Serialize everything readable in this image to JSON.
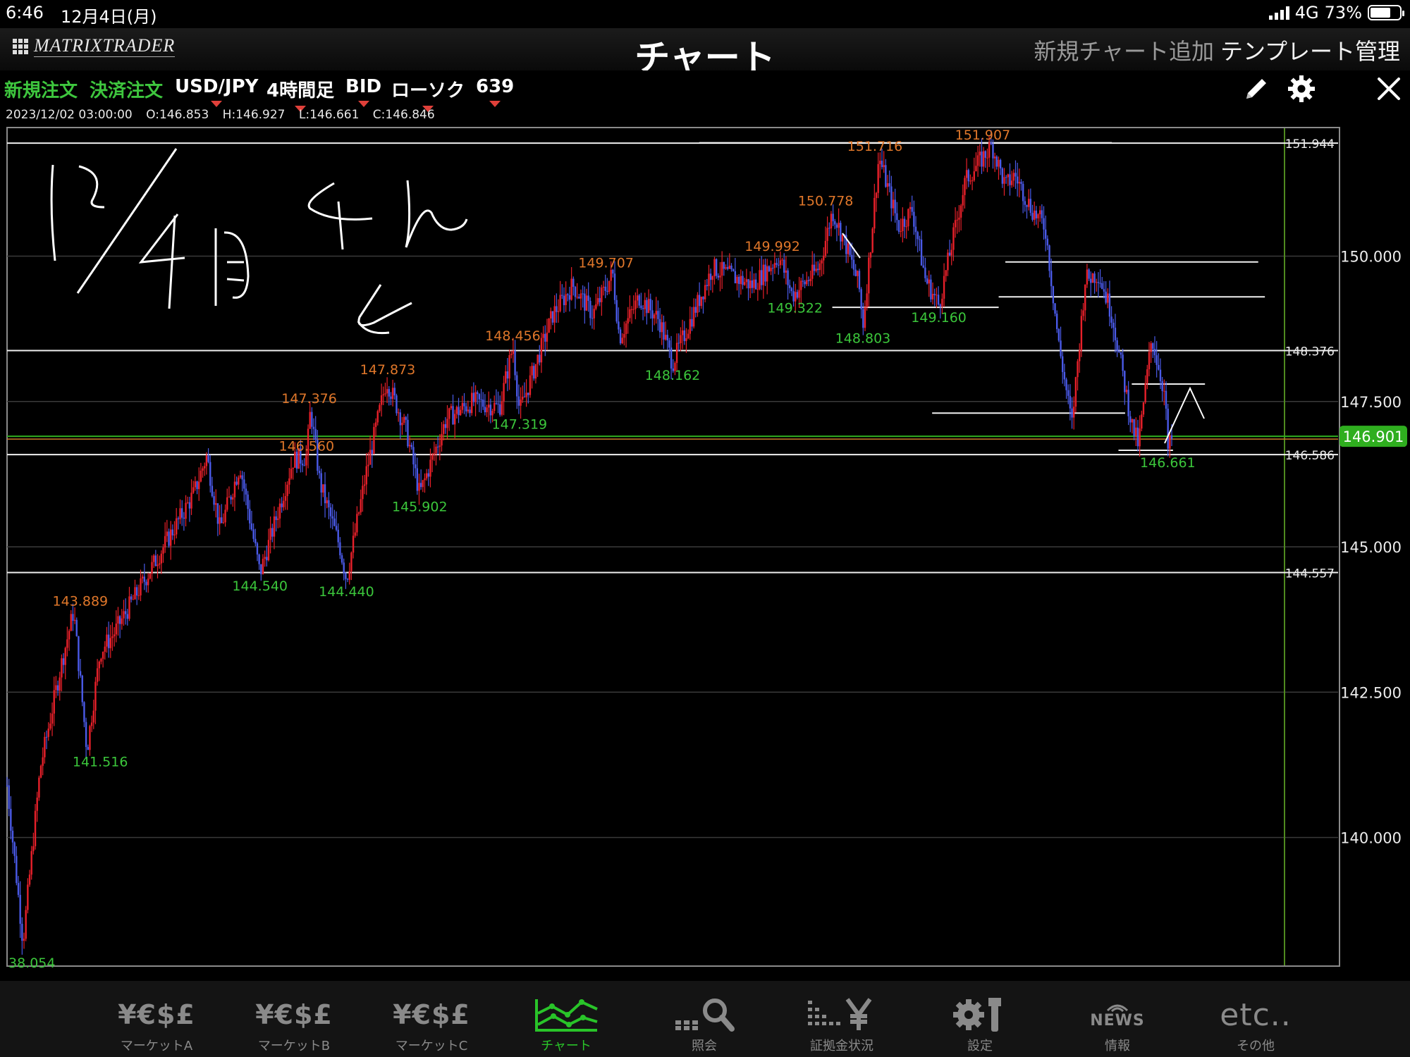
{
  "status_bar": {
    "time": "6:46",
    "date": "12月4日(月)",
    "network": "4G",
    "battery": "73%"
  },
  "nav": {
    "logo": "MATRIXTRADER",
    "title": "チャート",
    "add_chart": "新規チャート追加",
    "template": "テンプレート管理"
  },
  "toolbar": {
    "new_order": "新規注文",
    "close_order": "決済注文",
    "pair": "USD/JPY",
    "timeframe": "4時間足",
    "side": "BID",
    "chart_style": "ローソク",
    "bars": "639"
  },
  "ohlc": {
    "datetime": "2023/12/02 03:00:00",
    "open": "O:146.853",
    "high": "H:146.927",
    "low": "L:146.661",
    "close": "C:146.846"
  },
  "chart_data": {
    "type": "candlestick",
    "pair": "USD/JPY",
    "y_ticks": [
      "150.000",
      "147.500",
      "145.000",
      "142.500",
      "140.000"
    ],
    "ylim": [
      137.8,
      152.2
    ],
    "current_price": "146.901",
    "line_labels": [
      "151.944",
      "148.376",
      "146.586",
      "144.557"
    ],
    "marker_labels": [
      {
        "text": "151.907",
        "kind": "high"
      },
      {
        "text": "151.716",
        "kind": "high"
      },
      {
        "text": "150.778",
        "kind": "high"
      },
      {
        "text": "149.992",
        "kind": "high"
      },
      {
        "text": "149.707",
        "kind": "high"
      },
      {
        "text": "148.456",
        "kind": "high"
      },
      {
        "text": "147.873",
        "kind": "high"
      },
      {
        "text": "147.376",
        "kind": "high"
      },
      {
        "text": "146.560",
        "kind": "high"
      },
      {
        "text": "143.889",
        "kind": "high"
      },
      {
        "text": "149.322",
        "kind": "low"
      },
      {
        "text": "149.160",
        "kind": "low"
      },
      {
        "text": "148.803",
        "kind": "low"
      },
      {
        "text": "148.162",
        "kind": "low"
      },
      {
        "text": "147.319",
        "kind": "low"
      },
      {
        "text": "145.902",
        "kind": "low"
      },
      {
        "text": "144.540",
        "kind": "low"
      },
      {
        "text": "144.440",
        "kind": "low"
      },
      {
        "text": "141.516",
        "kind": "low"
      },
      {
        "text": "146.661",
        "kind": "low"
      },
      {
        "text": "38.054",
        "kind": "low"
      }
    ],
    "path_points": [
      [
        0,
        140.9
      ],
      [
        0.012,
        138.2
      ],
      [
        0.025,
        141.2
      ],
      [
        0.04,
        142.9
      ],
      [
        0.05,
        143.9
      ],
      [
        0.06,
        141.5
      ],
      [
        0.07,
        143.2
      ],
      [
        0.08,
        143.5
      ],
      [
        0.11,
        144.7
      ],
      [
        0.14,
        145.9
      ],
      [
        0.15,
        146.56
      ],
      [
        0.16,
        145.3
      ],
      [
        0.175,
        146.4
      ],
      [
        0.19,
        144.54
      ],
      [
        0.215,
        146.5
      ],
      [
        0.225,
        146.55
      ],
      [
        0.228,
        147.376
      ],
      [
        0.235,
        146.1
      ],
      [
        0.25,
        145.0
      ],
      [
        0.255,
        144.44
      ],
      [
        0.27,
        146.3
      ],
      [
        0.285,
        147.873
      ],
      [
        0.3,
        147.0
      ],
      [
        0.31,
        145.902
      ],
      [
        0.33,
        147.2
      ],
      [
        0.35,
        147.5
      ],
      [
        0.37,
        147.4
      ],
      [
        0.38,
        148.456
      ],
      [
        0.385,
        147.319
      ],
      [
        0.41,
        149.0
      ],
      [
        0.425,
        149.5
      ],
      [
        0.44,
        149.0
      ],
      [
        0.455,
        149.707
      ],
      [
        0.46,
        148.6
      ],
      [
        0.475,
        149.3
      ],
      [
        0.49,
        148.9
      ],
      [
        0.5,
        148.162
      ],
      [
        0.53,
        149.8
      ],
      [
        0.56,
        149.5
      ],
      [
        0.58,
        149.992
      ],
      [
        0.59,
        149.322
      ],
      [
        0.61,
        149.8
      ],
      [
        0.62,
        150.778
      ],
      [
        0.63,
        150.2
      ],
      [
        0.64,
        149.5
      ],
      [
        0.643,
        148.803
      ],
      [
        0.655,
        151.716
      ],
      [
        0.67,
        150.5
      ],
      [
        0.68,
        150.8
      ],
      [
        0.69,
        149.6
      ],
      [
        0.7,
        149.16
      ],
      [
        0.72,
        151.3
      ],
      [
        0.74,
        151.907
      ],
      [
        0.75,
        151.2
      ],
      [
        0.757,
        151.4
      ],
      [
        0.77,
        150.8
      ],
      [
        0.78,
        150.5
      ],
      [
        0.79,
        148.5
      ],
      [
        0.8,
        147.1
      ],
      [
        0.81,
        149.6
      ],
      [
        0.82,
        149.7
      ],
      [
        0.83,
        149.0
      ],
      [
        0.845,
        147.1
      ],
      [
        0.85,
        146.75
      ],
      [
        0.86,
        148.6
      ],
      [
        0.87,
        147.6
      ],
      [
        0.872,
        146.661
      ],
      [
        0.875,
        146.85
      ]
    ]
  },
  "tabs": [
    {
      "icon": "¥€$£",
      "label": "マーケットA"
    },
    {
      "icon": "¥€$£",
      "label": "マーケットB"
    },
    {
      "icon": "¥€$£",
      "label": "マーケットC"
    },
    {
      "icon": "",
      "label": "チャート"
    },
    {
      "icon": "",
      "label": "照会"
    },
    {
      "icon": "",
      "label": "証拠金状況"
    },
    {
      "icon": "",
      "label": "設定"
    },
    {
      "icon": "NEWS",
      "label": "情報"
    },
    {
      "icon": "etc..",
      "label": "その他"
    }
  ],
  "colors": {
    "high_label": "#e0772a",
    "low_label": "#3bc63b",
    "bull": "#e8202a",
    "bear": "#4a5ae8",
    "current": "#2fae1f",
    "accent": "#29c429"
  }
}
